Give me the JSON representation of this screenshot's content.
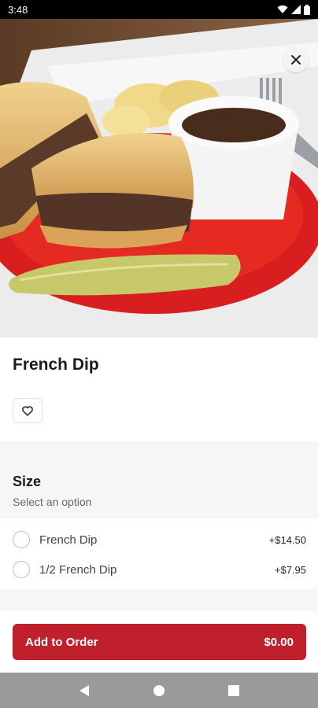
{
  "status_bar": {
    "time": "3:48",
    "icons": [
      "wifi-icon",
      "signal-icon",
      "battery-icon"
    ]
  },
  "item": {
    "title": "French Dip",
    "hero_image": "french-dip-sandwich-plate",
    "favorite_icon": "heart-outline-icon",
    "close_icon": "close-icon"
  },
  "size_section": {
    "title": "Size",
    "subtitle": "Select an option",
    "options": [
      {
        "label": "French Dip",
        "price": "+$14.50"
      },
      {
        "label": "1/2 French Dip",
        "price": "+$7.95"
      }
    ]
  },
  "footer": {
    "add_label": "Add to Order",
    "total": "$0.00"
  },
  "nav_bar": {
    "buttons": [
      "back-icon",
      "home-icon",
      "recents-icon"
    ]
  },
  "colors": {
    "accent": "#c0202c"
  }
}
